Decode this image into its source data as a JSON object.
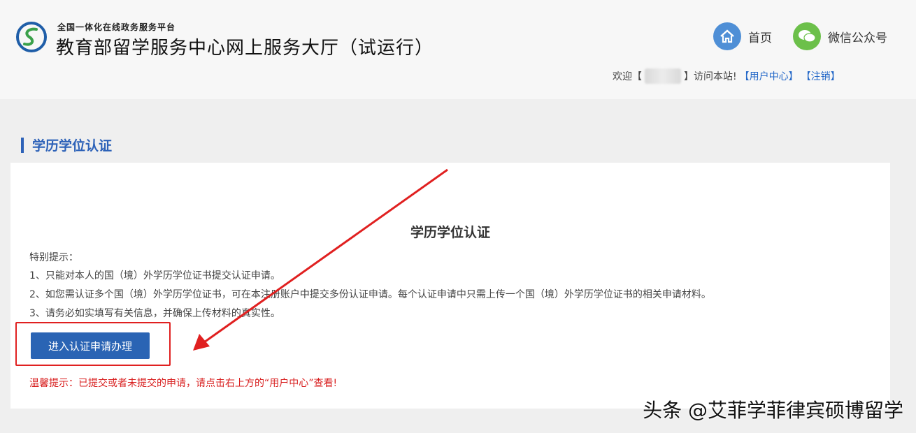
{
  "header": {
    "platform_subtitle": "全国一体化在线政务服务平台",
    "platform_title": "教育部留学服务中心网上服务大厅（试运行）",
    "nav": {
      "home_label": "首页",
      "wechat_label": "微信公众号"
    },
    "welcome": {
      "prefix": "欢迎【",
      "suffix": "】访问本站!",
      "user_center_link": "【用户中心】",
      "logout_link": "【注销】"
    }
  },
  "section": {
    "heading": "学历学位认证"
  },
  "panel": {
    "title": "学历学位认证",
    "notice_heading": "特别提示：",
    "notices": [
      "1、只能对本人的国（境）外学历学位证书提交认证申请。",
      "2、如您需认证多个国（境）外学历学位证书，可在本注册账户中提交多份认证申请。每个认证申请中只需上传一个国（境）外学历学位证书的相关申请材料。",
      "3、请务必如实填写有关信息，并确保上传材料的真实性。"
    ],
    "apply_button_label": "进入认证申请办理",
    "warm_tip": "温馨提示：已提交或者未提交的申请，请点击右上方的“用户中心”查看!"
  },
  "watermark": "头条 @艾菲学菲律宾硕博留学",
  "colors": {
    "accent_blue": "#2a64b4",
    "heading_blue": "#2d62b8",
    "alert_red": "#d81e1e",
    "annotation_red": "#e02020"
  }
}
